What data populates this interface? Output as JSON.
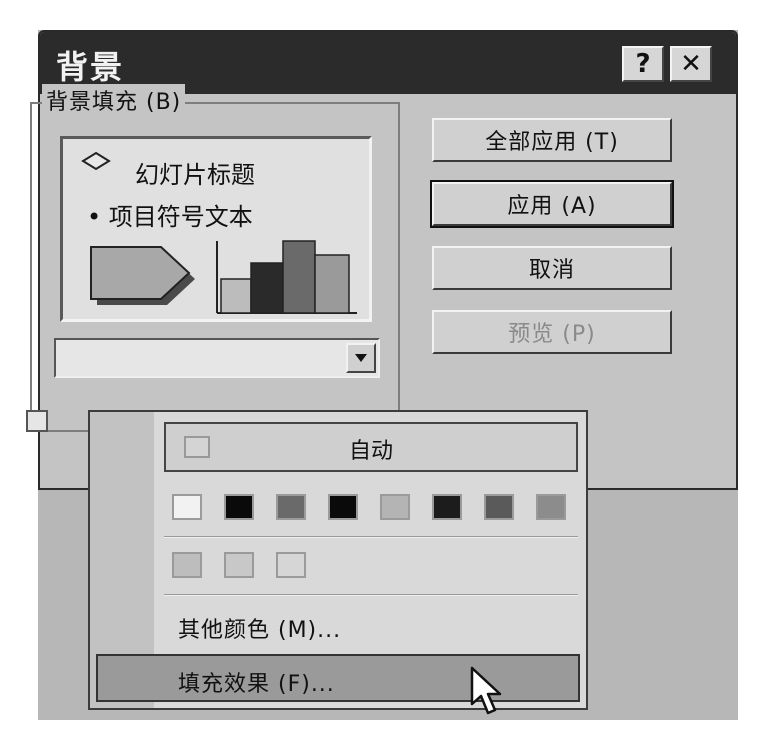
{
  "dialog": {
    "title": "背景",
    "help_label": "?",
    "close_label": "✕"
  },
  "group": {
    "label": "背景填充 (B)"
  },
  "preview": {
    "title": "幻灯片标题",
    "bullet": "• 项目符号文本"
  },
  "buttons": {
    "apply_all": "全部应用 (T)",
    "apply": "应用 (A)",
    "cancel": "取消",
    "preview": "预览 (P)"
  },
  "menu": {
    "auto_label": "自动",
    "colors_row1": [
      "#f2f2f2",
      "#0a0a0a",
      "#6a6a6a",
      "#0a0a0a",
      "#b4b4b4",
      "#1c1c1c",
      "#5a5a5a",
      "#8c8c8c"
    ],
    "colors_row2": [
      "#bdbdbd",
      "#c8c8c8",
      "#d6d6d6"
    ],
    "more_colors": "其他颜色 (M)...",
    "fill_effects": "填充效果 (F)..."
  },
  "icons": {
    "cursor": "arrow-cursor-icon",
    "dropdown": "chevron-down-icon"
  }
}
